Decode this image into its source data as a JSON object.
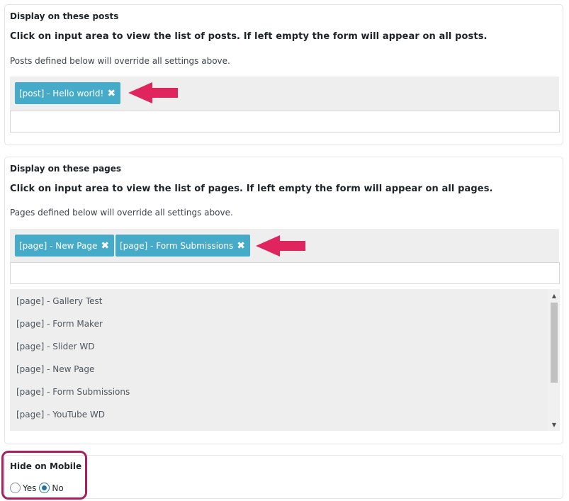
{
  "posts_section": {
    "title": "Display on these posts",
    "description": "Click on input area to view the list of posts. If left empty the form will appear on all posts.",
    "note": "Posts defined below will override all settings above.",
    "selected": [
      {
        "label": "[post] - Hello world!",
        "remove": "✖"
      }
    ],
    "input_value": ""
  },
  "pages_section": {
    "title": "Display on these pages",
    "description": "Click on input area to view the list of pages. If left empty the form will appear on all pages.",
    "note": "Pages defined below will override all settings above.",
    "selected": [
      {
        "label": "[page] - New Page",
        "remove": "✖"
      },
      {
        "label": "[page] - Form Submissions",
        "remove": "✖"
      }
    ],
    "input_value": "",
    "dropdown_options": [
      "[page] - Gallery Test",
      "[page] - Form Maker",
      "[page] - Slider WD",
      "[page] - New Page",
      "[page] - Form Submissions",
      "[page] - YouTube WD"
    ]
  },
  "mobile_section": {
    "title": "Hide on Mobile",
    "options": [
      "Yes",
      "No"
    ],
    "selected": "No"
  },
  "colors": {
    "tag_bg": "#46abc8",
    "arrow": "#e0245e",
    "highlight_border": "#a6205f",
    "radio_checked": "#2271b1"
  },
  "icons": {
    "remove_tag": "close-icon",
    "annotation": "arrow-left-icon",
    "scroll_up": "chevron-up-icon",
    "scroll_down": "chevron-down-icon"
  }
}
